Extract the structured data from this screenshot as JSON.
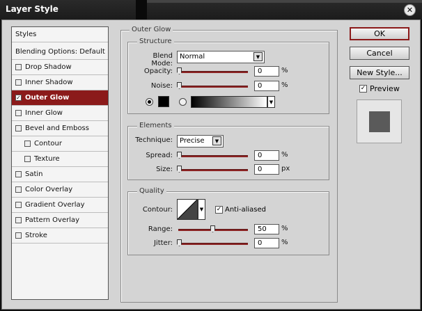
{
  "window": {
    "title": "Layer Style"
  },
  "styles_list": {
    "items": [
      {
        "label": "Styles"
      },
      {
        "label": "Blending Options: Default"
      },
      {
        "label": "Drop Shadow",
        "checked": false
      },
      {
        "label": "Inner Shadow",
        "checked": false
      },
      {
        "label": "Outer Glow",
        "checked": true,
        "selected": true
      },
      {
        "label": "Inner Glow",
        "checked": false
      },
      {
        "label": "Bevel and Emboss",
        "checked": false
      },
      {
        "label": "Contour",
        "checked": false
      },
      {
        "label": "Texture",
        "checked": false
      },
      {
        "label": "Satin",
        "checked": false
      },
      {
        "label": "Color Overlay",
        "checked": false
      },
      {
        "label": "Gradient Overlay",
        "checked": false
      },
      {
        "label": "Pattern Overlay",
        "checked": false
      },
      {
        "label": "Stroke",
        "checked": false
      }
    ]
  },
  "panel": {
    "title": "Outer Glow",
    "structure": {
      "legend": "Structure",
      "blend_mode_label": "Blend Mode:",
      "blend_mode_value": "Normal",
      "opacity_label": "Opacity:",
      "opacity_value": "0",
      "noise_label": "Noise:",
      "noise_value": "0",
      "percent": "%",
      "glow_color": "#000000",
      "gradient_from": "#000000",
      "gradient_to": "#ffffff",
      "mode": "color"
    },
    "elements": {
      "legend": "Elements",
      "technique_label": "Technique:",
      "technique_value": "Precise",
      "spread_label": "Spread:",
      "spread_value": "0",
      "size_label": "Size:",
      "size_value": "0",
      "percent": "%",
      "px": "px"
    },
    "quality": {
      "legend": "Quality",
      "contour_label": "Contour:",
      "anti_aliased_label": "Anti-aliased",
      "anti_aliased": true,
      "range_label": "Range:",
      "range_value": "50",
      "jitter_label": "Jitter:",
      "jitter_value": "0",
      "percent": "%"
    }
  },
  "buttons": {
    "ok": "OK",
    "cancel": "Cancel",
    "new_style": "New Style...",
    "preview_label": "Preview",
    "preview_checked": true
  },
  "colors": {
    "accent": "#8b1a1a",
    "preview_swatch": "#5a5a5a"
  }
}
